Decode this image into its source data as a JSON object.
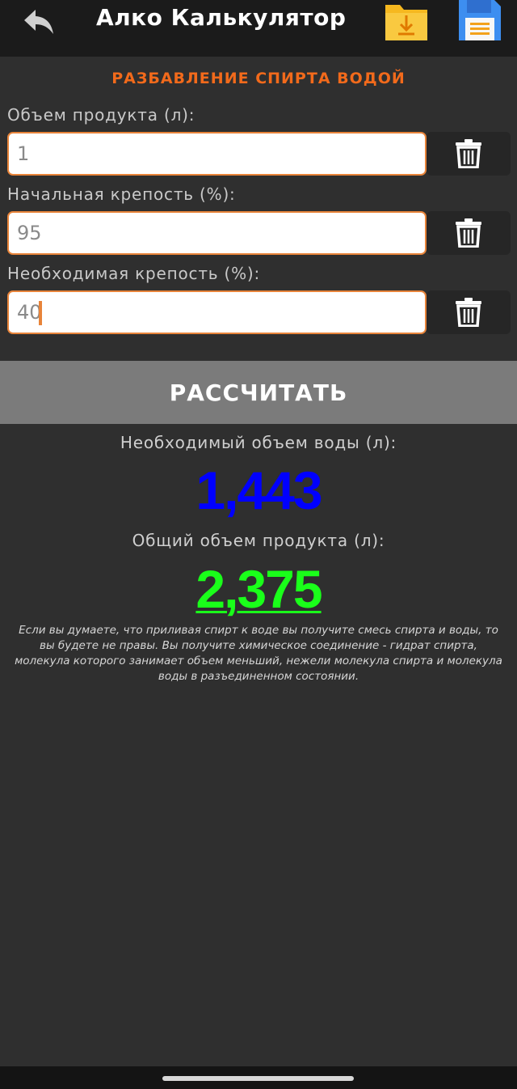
{
  "appbar": {
    "title": "Алко Калькулятор",
    "back_icon": "back-arrow-icon",
    "folder_icon": "folder-download-icon",
    "save_icon": "floppy-save-icon"
  },
  "form": {
    "section_title": "РАЗБАВЛЕНИЕ СПИРТА ВОДОЙ",
    "fields": [
      {
        "label": "Объем продукта (л):",
        "value": "1"
      },
      {
        "label": "Начальная крепость (%):",
        "value": "95"
      },
      {
        "label": "Необходимая крепость (%):",
        "value": "40"
      }
    ],
    "clear_icon": "trash-icon"
  },
  "calc_button": "РАССЧИТАТЬ",
  "results": {
    "water_label": "Необходимый объем воды (л):",
    "water_value": "1,443",
    "total_label": "Общий объем продукта (л):",
    "total_value": "2,375",
    "note": "Если вы думаете, что приливая спирт к воде вы получите смесь спирта и воды, то вы будете не правы. Вы получите химическое соединение - гидрат спирта, молекула которого занимает объем меньший, нежели молекула спирта и молекула воды в разъединенном состоянии."
  },
  "colors": {
    "accent": "#f26a1b",
    "input_border": "#e8843a",
    "water_value": "#0000ff",
    "total_value": "#1aff1a",
    "button_bg": "#7b7b7b"
  }
}
